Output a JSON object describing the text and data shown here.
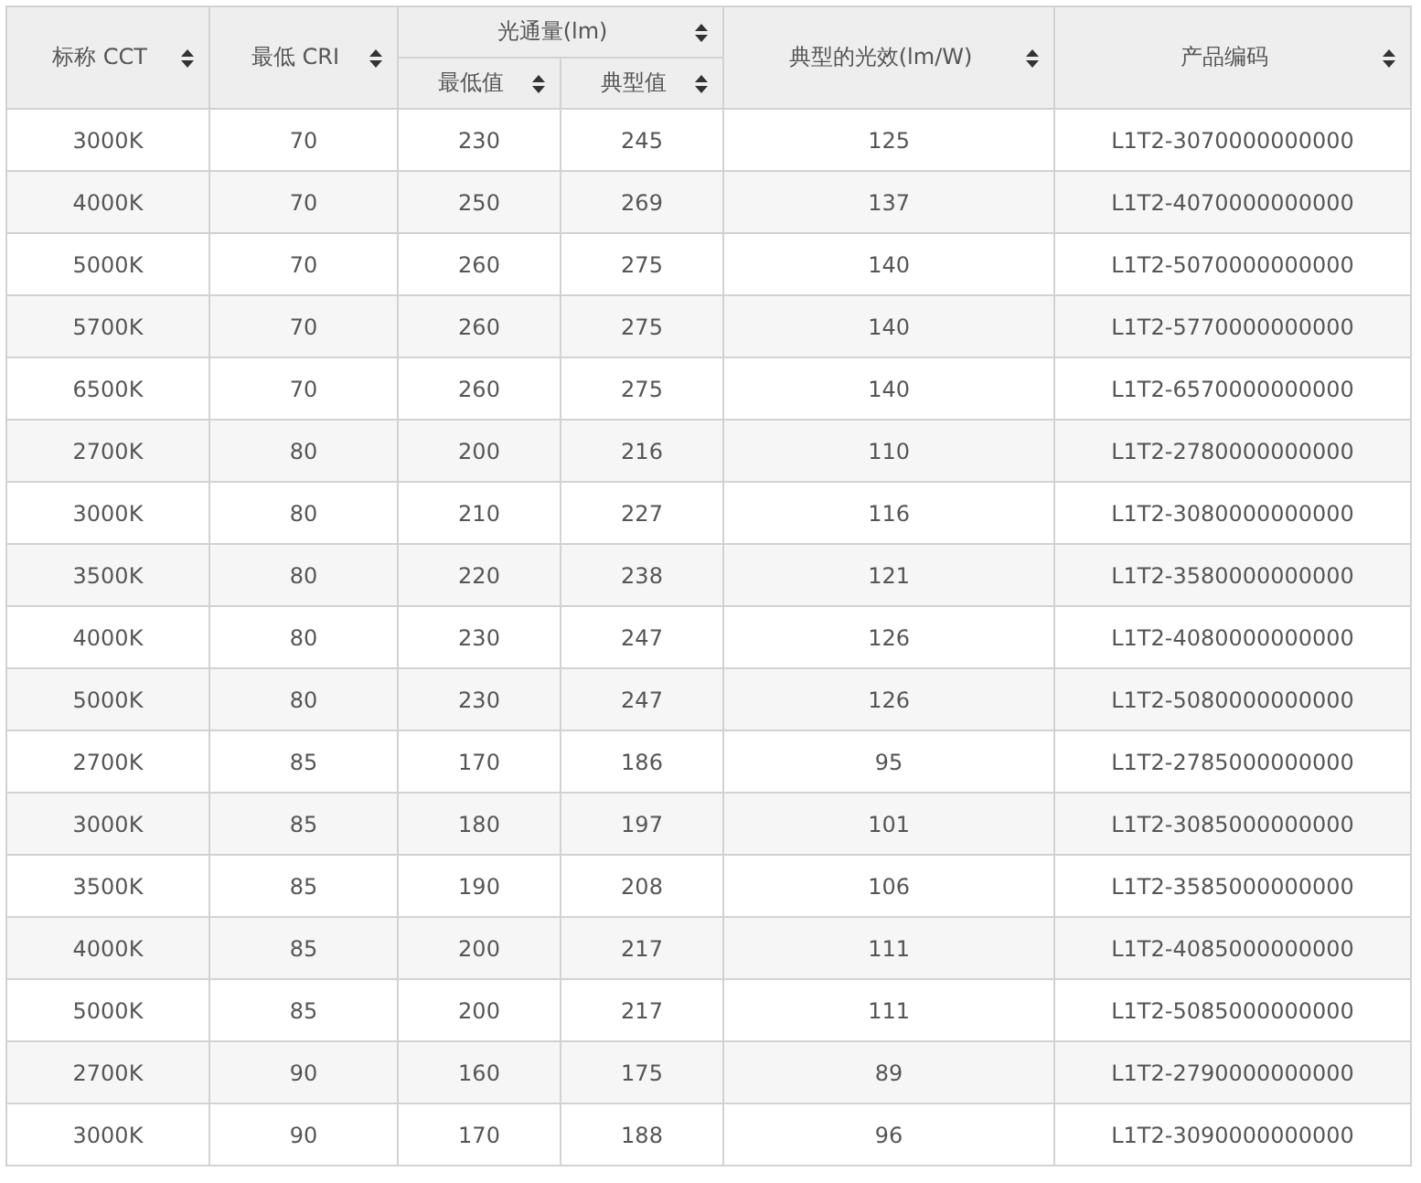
{
  "table": {
    "columns": [
      {
        "label": "标称 CCT"
      },
      {
        "label": "最低 CRI"
      },
      {
        "label": "光通量(lm)",
        "colspan": 2,
        "children": [
          {
            "label": "最低值"
          },
          {
            "label": "典型值"
          }
        ]
      },
      {
        "label": "典型的光效(lm/W)"
      },
      {
        "label": "产品编码"
      }
    ],
    "rows": [
      [
        "3000K",
        "70",
        "230",
        "245",
        "125",
        "L1T2-3070000000000"
      ],
      [
        "4000K",
        "70",
        "250",
        "269",
        "137",
        "L1T2-4070000000000"
      ],
      [
        "5000K",
        "70",
        "260",
        "275",
        "140",
        "L1T2-5070000000000"
      ],
      [
        "5700K",
        "70",
        "260",
        "275",
        "140",
        "L1T2-5770000000000"
      ],
      [
        "6500K",
        "70",
        "260",
        "275",
        "140",
        "L1T2-6570000000000"
      ],
      [
        "2700K",
        "80",
        "200",
        "216",
        "110",
        "L1T2-2780000000000"
      ],
      [
        "3000K",
        "80",
        "210",
        "227",
        "116",
        "L1T2-3080000000000"
      ],
      [
        "3500K",
        "80",
        "220",
        "238",
        "121",
        "L1T2-3580000000000"
      ],
      [
        "4000K",
        "80",
        "230",
        "247",
        "126",
        "L1T2-4080000000000"
      ],
      [
        "5000K",
        "80",
        "230",
        "247",
        "126",
        "L1T2-5080000000000"
      ],
      [
        "2700K",
        "85",
        "170",
        "186",
        "95",
        "L1T2-2785000000000"
      ],
      [
        "3000K",
        "85",
        "180",
        "197",
        "101",
        "L1T2-3085000000000"
      ],
      [
        "3500K",
        "85",
        "190",
        "208",
        "106",
        "L1T2-3585000000000"
      ],
      [
        "4000K",
        "85",
        "200",
        "217",
        "111",
        "L1T2-4085000000000"
      ],
      [
        "5000K",
        "85",
        "200",
        "217",
        "111",
        "L1T2-5085000000000"
      ],
      [
        "2700K",
        "90",
        "160",
        "175",
        "89",
        "L1T2-2790000000000"
      ],
      [
        "3000K",
        "90",
        "170",
        "188",
        "96",
        "L1T2-3090000000000"
      ]
    ]
  }
}
